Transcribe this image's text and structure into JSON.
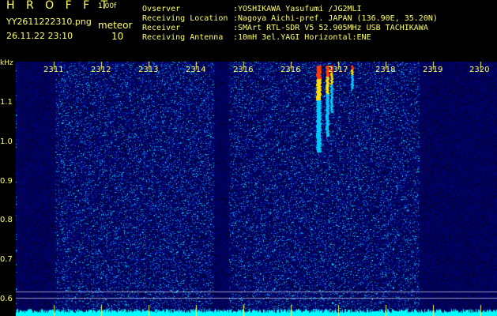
{
  "header": {
    "app_title": "H R O F F T",
    "app_version": "1.00f",
    "filename": "YY2611222310.png",
    "datetime": "26.11.22 23:10",
    "meteor_label": "meteor",
    "meteor_count": "10"
  },
  "info": [
    {
      "key": "Ovserver",
      "value": ":YOSHIKAWA Yasufumi /JG2MLI"
    },
    {
      "key": "Receiving Location",
      "value": ":Nagoya Aichi-pref. JAPAN (136.90E, 35.20N)"
    },
    {
      "key": "Receiver",
      "value": ":SMArt RTL-SDR V5 52.905MHz USB TACHIKAWA"
    },
    {
      "key": "Receiving Antenna",
      "value": ":10mH 3el.YAGI Horizontal:ENE"
    }
  ],
  "axis": {
    "y_unit": "kHz",
    "y_ticks": [
      "1.1",
      "1.0",
      "0.9",
      "0.8",
      "0.7",
      "0.6"
    ],
    "x_ticks": [
      "2311",
      "2312",
      "2313",
      "2314",
      "2316",
      "2316",
      "2317",
      "2318",
      "2319",
      "2320"
    ]
  },
  "colors": {
    "label": "#ffff66",
    "background": "#000000",
    "noise_base": "#10108a",
    "trace_cyan": "#00ffff"
  }
}
